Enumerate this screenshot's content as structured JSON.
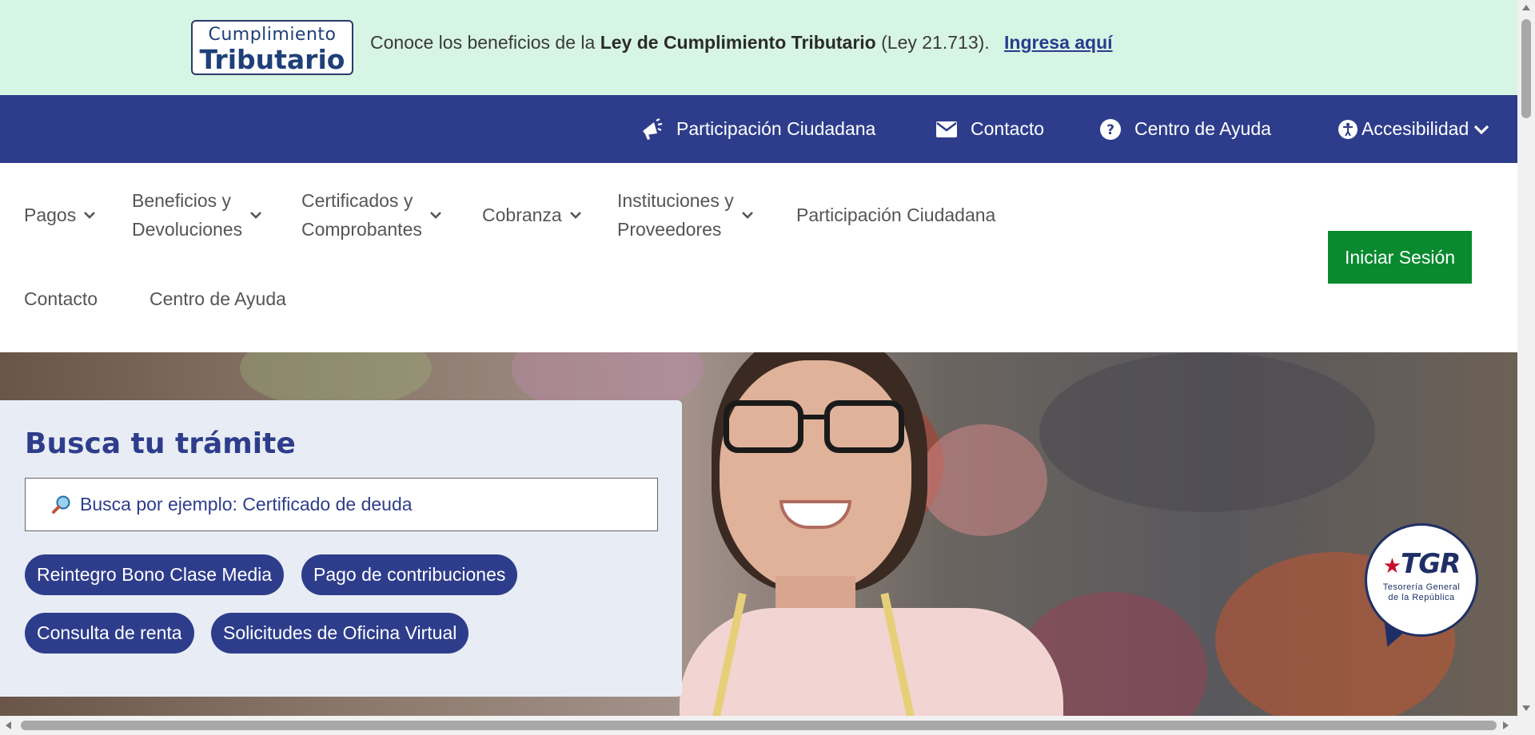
{
  "banner": {
    "logo_line1": "Cumplimiento",
    "logo_line2": "Tributario",
    "text_prefix": "Conoce los beneficios de la ",
    "text_bold": "Ley de Cumplimiento Tributario",
    "text_suffix": " (Ley 21.713).",
    "link": "Ingresa aquí"
  },
  "utility_bar": {
    "items": [
      {
        "label": "Participación Ciudadana",
        "icon": "megaphone-icon"
      },
      {
        "label": "Contacto",
        "icon": "envelope-icon"
      },
      {
        "label": "Centro de Ayuda",
        "icon": "question-circle-icon"
      },
      {
        "label": "Accesibilidad",
        "icon": "accessibility-icon"
      }
    ]
  },
  "main_nav": {
    "items": [
      {
        "label": "Pagos",
        "dropdown": true
      },
      {
        "label_line1": "Beneficios y",
        "label_line2": "Devoluciones",
        "dropdown": true
      },
      {
        "label_line1": "Certificados y",
        "label_line2": "Comprobantes",
        "dropdown": true
      },
      {
        "label": "Cobranza",
        "dropdown": true
      },
      {
        "label_line1": "Instituciones y",
        "label_line2": "Proveedores",
        "dropdown": true
      },
      {
        "label": "Participación Ciudadana",
        "dropdown": false
      },
      {
        "label": "Contacto",
        "dropdown": false
      },
      {
        "label": "Centro de Ayuda",
        "dropdown": false
      }
    ],
    "login_button": "Iniciar Sesión"
  },
  "hero": {
    "search_title": "Busca tu trámite",
    "search_placeholder": "Busca por ejemplo: Certificado de deuda",
    "quick_links": [
      "Reintegro Bono Clase Media",
      "Pago de contribuciones",
      "Consulta de renta",
      "Solicitudes de Oficina Virtual"
    ],
    "badge_title": "TGR",
    "badge_subtitle_line1": "Tesorería General",
    "badge_subtitle_line2": "de la República"
  },
  "colors": {
    "banner_bg": "#d7f5e5",
    "primary_navy": "#2e3d8b",
    "login_green": "#0a8a2f",
    "search_card_bg": "#e8edf5"
  }
}
